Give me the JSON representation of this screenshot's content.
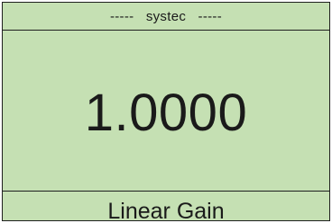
{
  "header": {
    "title": "-----   systec   -----"
  },
  "display": {
    "value": "1.0000"
  },
  "footer": {
    "label": "Linear Gain"
  },
  "colors": {
    "background": "#c5e0b3",
    "border": "#1f1f1f",
    "text": "#1a1a1a"
  }
}
